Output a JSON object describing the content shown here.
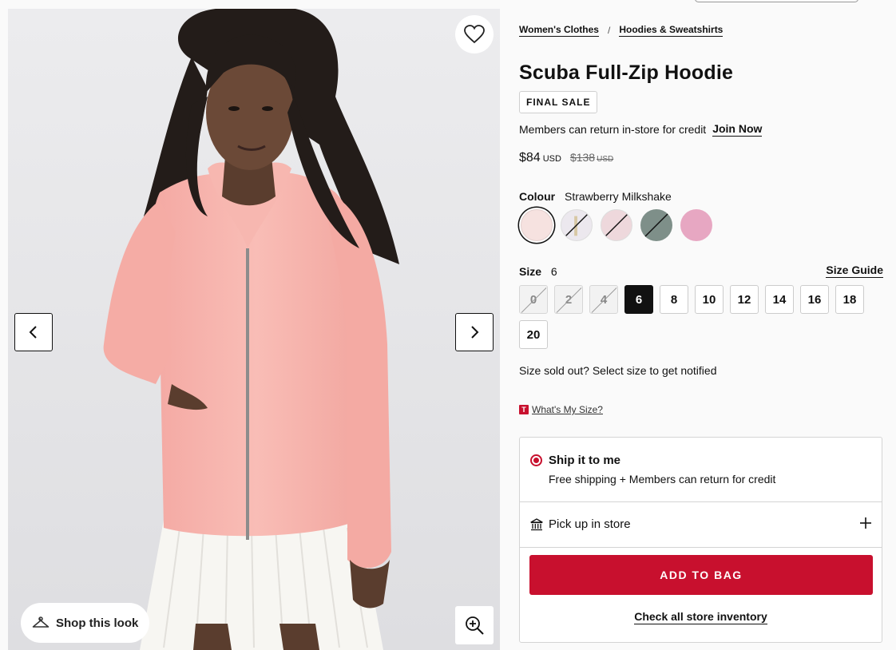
{
  "product": {
    "title": "Scuba Full-Zip Hoodie",
    "badge": "FINAL SALE",
    "member_note": "Members can return in-store for credit",
    "join_label": "Join Now",
    "price_now": "$84",
    "price_now_currency": "USD",
    "price_was": "$138",
    "price_was_currency": "USD"
  },
  "breadcrumb": {
    "items": [
      "Women's Clothes",
      "Hoodies & Sweatshirts"
    ],
    "separator": "/"
  },
  "colour": {
    "label": "Colour",
    "selected": "Strawberry Milkshake",
    "swatches": [
      {
        "name": "strawberry-milkshake",
        "color": "#f6e2e0",
        "available": true,
        "selected": true
      },
      {
        "name": "heathered-white-zip",
        "color": "#ece8ee",
        "available": false,
        "selected": false
      },
      {
        "name": "pink-heather",
        "color": "#eed8dc",
        "available": false,
        "selected": false
      },
      {
        "name": "grey-sage",
        "color": "#7e8f89",
        "available": false,
        "selected": false
      },
      {
        "name": "pink-bloom",
        "color": "#e7a7c2",
        "available": true,
        "selected": false
      }
    ]
  },
  "size": {
    "label": "Size",
    "selected": "6",
    "guide_label": "Size Guide",
    "options": [
      {
        "label": "0",
        "available": false
      },
      {
        "label": "2",
        "available": false
      },
      {
        "label": "4",
        "available": false
      },
      {
        "label": "6",
        "available": true,
        "active": true
      },
      {
        "label": "8",
        "available": true
      },
      {
        "label": "10",
        "available": true
      },
      {
        "label": "12",
        "available": true
      },
      {
        "label": "14",
        "available": true
      },
      {
        "label": "16",
        "available": true
      },
      {
        "label": "18",
        "available": true
      },
      {
        "label": "20",
        "available": true
      }
    ],
    "soldout_note": "Size sold out? Select size to get notified",
    "whats_my_size": "What's My Size?",
    "whats_my_size_logo": "T"
  },
  "fulfillment": {
    "ship_title": "Ship it to me",
    "ship_sub": "Free shipping + Members can return for credit",
    "pickup_label": "Pick up in store",
    "add_to_bag": "ADD TO BAG",
    "check_inventory": "Check all store inventory"
  },
  "gallery": {
    "shop_look": "Shop this look",
    "icons": [
      "heart-icon",
      "chevron-left-icon",
      "chevron-right-icon",
      "hanger-icon",
      "zoom-in-icon"
    ]
  },
  "colors": {
    "accent": "#c8102e",
    "product_pink": "#f7b3ad",
    "background": "#e6e6e8"
  }
}
